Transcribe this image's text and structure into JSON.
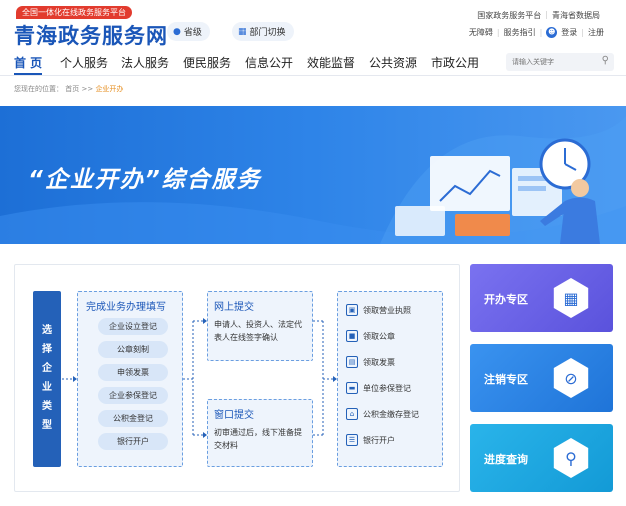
{
  "header": {
    "tagline": "全国一体化在线政务服务平台",
    "site_title": "青海政务服务网",
    "region_pill": "省级",
    "dept_pill": "部门切换",
    "top_links": [
      "国家政务服务平台",
      "青海省数据局"
    ],
    "access_links": [
      "无障碍",
      "服务指引"
    ],
    "login": "登录",
    "register": "注册"
  },
  "nav": {
    "items": [
      "首 页",
      "个人服务",
      "法人服务",
      "便民服务",
      "信息公开",
      "效能监督",
      "公共资源",
      "市政公用"
    ],
    "active_index": 0
  },
  "search": {
    "placeholder": "请输入关键字"
  },
  "breadcrumb": {
    "prefix": "您现在的位置：",
    "home": "首页",
    "sep": ">>",
    "current": "企业开办"
  },
  "banner": {
    "title": "“企业开办”综合服务"
  },
  "flow": {
    "select_label": "选择企业类型",
    "fill": {
      "title": "完成业务办理填写",
      "items": [
        "企业设立登记",
        "公章刻制",
        "申领发票",
        "企业参保登记",
        "公积金登记",
        "银行开户"
      ]
    },
    "online": {
      "title": "网上提交",
      "desc": "申请人、投资人、法定代表人在线签字确认"
    },
    "window": {
      "title": "窗口提交",
      "desc": "初审通过后，线下准备提交材料"
    },
    "results": [
      "领取营业执照",
      "领取公章",
      "领取发票",
      "单位参保登记",
      "公积金缴存登记",
      "银行开户"
    ]
  },
  "zones": [
    {
      "label": "开办专区",
      "color": "#6b64e8",
      "icon": "building-icon"
    },
    {
      "label": "注销专区",
      "color": "#2b86e8",
      "icon": "cancel-building-icon"
    },
    {
      "label": "进度查询",
      "color": "#1ea6e0",
      "icon": "search-doc-icon"
    }
  ],
  "colors": {
    "brand": "#1a56b8",
    "accent_red": "#e23b2e",
    "crumb_current": "#e58b1a"
  }
}
